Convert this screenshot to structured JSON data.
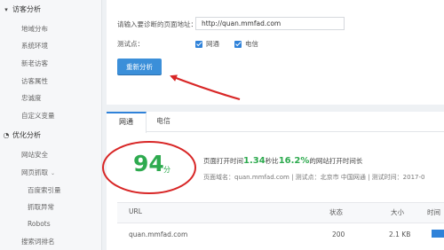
{
  "sidebar": {
    "visitor_section": "访客分析",
    "visitor_items": [
      "地域分布",
      "系统环境",
      "新老访客",
      "访客属性",
      "忠诚度",
      "自定义变量"
    ],
    "optimize_section": "优化分析",
    "optimize_items": [
      "网站安全",
      "网页抓取"
    ],
    "crawl_subitems": [
      "百度索引量",
      "抓取异常",
      "Robots"
    ],
    "last_item": "搜索词排名"
  },
  "form": {
    "url_label": "请输入要诊断的页面地址：",
    "url_value": "http://quan.mmfad.com",
    "test_label": "测试点：",
    "checkbox_1": "网通",
    "checkbox_2": "电信",
    "submit_label": "重新分析"
  },
  "tabs": [
    "网通",
    "电信"
  ],
  "result": {
    "score": "94",
    "score_unit": "分",
    "summary_prefix": "页面打开时间",
    "load_time": "1.34",
    "summary_mid": "秒比",
    "percent": "16.2%",
    "summary_suffix": "的网站打开时间长",
    "meta_text": "页面域名：quan.mmfad.com  |  测试点：北京市  中国网通  |  测试时间：2017-0"
  },
  "table": {
    "headers": [
      "URL",
      "状态",
      "大小",
      "时间"
    ],
    "rows": [
      {
        "url": "quan.mmfad.com",
        "status": "200",
        "size": "2.1 KB",
        "time_fraction": 1.0
      }
    ]
  },
  "colors": {
    "accent": "#2f82d9",
    "score_green": "#2eaa4f",
    "annotation_red": "#d82626"
  }
}
